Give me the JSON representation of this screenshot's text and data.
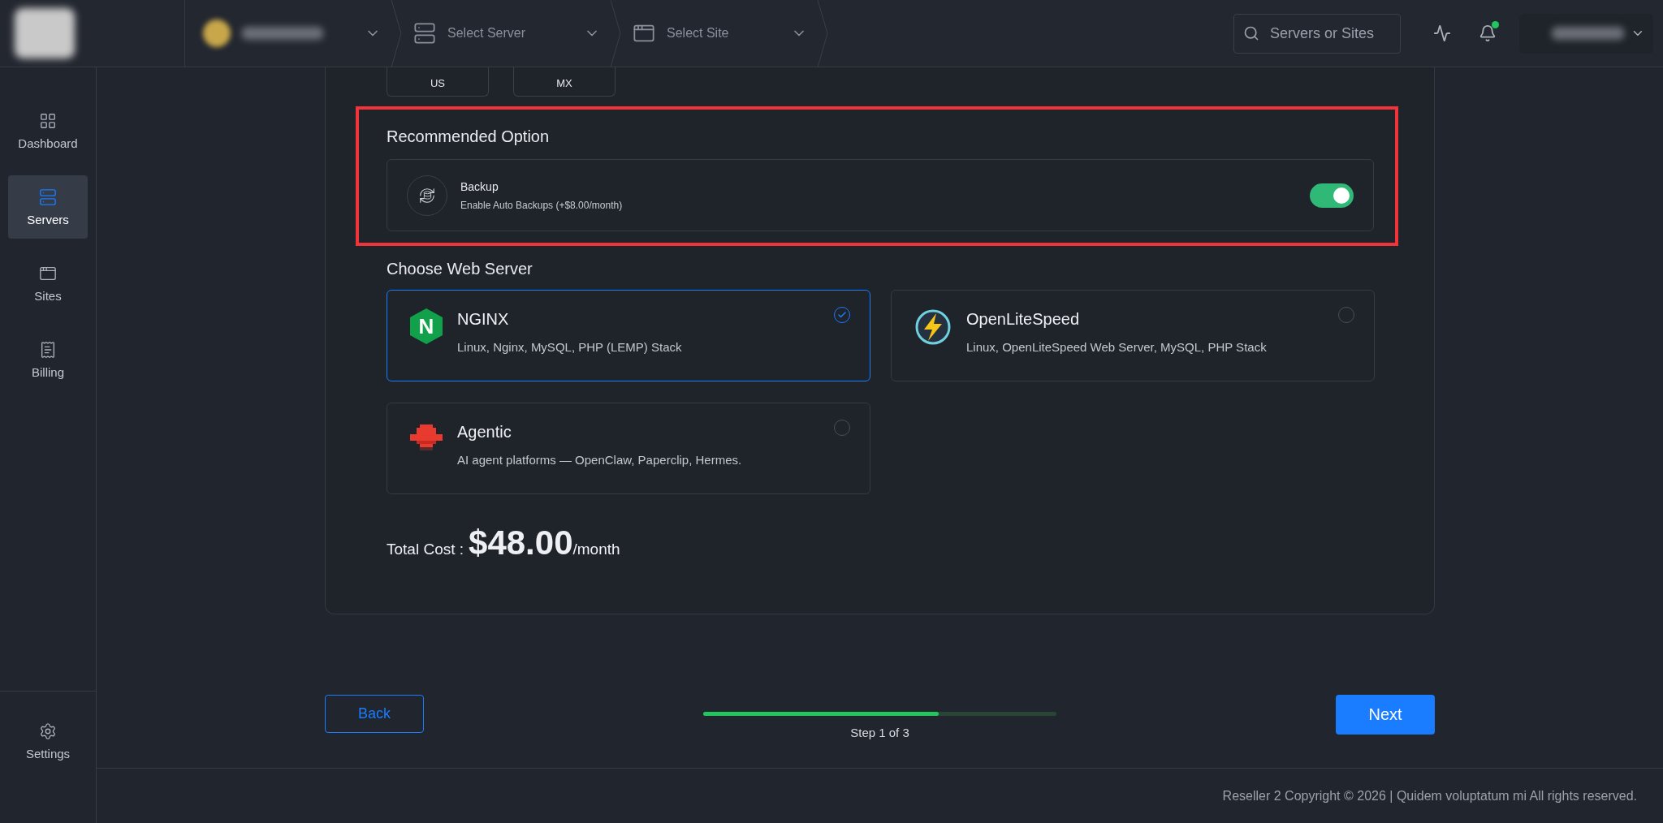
{
  "topbar": {
    "breadcrumbs": [
      {
        "kind": "org"
      },
      {
        "kind": "server",
        "placeholder": "Select Server"
      },
      {
        "kind": "site",
        "placeholder": "Select Site"
      }
    ],
    "search": {
      "placeholder": "Servers or Sites"
    },
    "notifications": {
      "unread": true
    }
  },
  "sidebar": {
    "items": [
      {
        "label": "Dashboard",
        "selected": false
      },
      {
        "label": "Servers",
        "selected": true
      },
      {
        "label": "Sites",
        "selected": false
      },
      {
        "label": "Billing",
        "selected": false
      }
    ],
    "settings": {
      "label": "Settings"
    }
  },
  "regions": [
    {
      "label": "US",
      "selected": false
    },
    {
      "label": "MX",
      "selected": false
    }
  ],
  "recommended": {
    "title": "Recommended Option",
    "option": {
      "title": "Backup",
      "description": "Enable Auto Backups (+$8.00/month)",
      "on": true
    }
  },
  "web_server": {
    "title": "Choose Web Server",
    "options": [
      {
        "kind": "nginx",
        "logo_letter": "N",
        "name": "NGINX",
        "description": "Linux, Nginx, MySQL, PHP (LEMP) Stack",
        "selected": true
      },
      {
        "kind": "openlitespeed",
        "name": "OpenLiteSpeed",
        "description": "Linux, OpenLiteSpeed Web Server, MySQL, PHP Stack",
        "selected": false
      },
      {
        "kind": "agentic",
        "name": "Agentic",
        "description": "AI agent platforms — OpenClaw, Paperclip, Hermes.",
        "selected": false
      }
    ]
  },
  "total": {
    "label": "Total Cost :",
    "amount": "$48.00",
    "period": "/month"
  },
  "wizard": {
    "back": "Back",
    "next": "Next",
    "step": "Step 1 of 3",
    "level": 0.667
  },
  "footer": "Reseller 2 Copyright © 2026 | Quidem voluptatum mi All rights reserved."
}
